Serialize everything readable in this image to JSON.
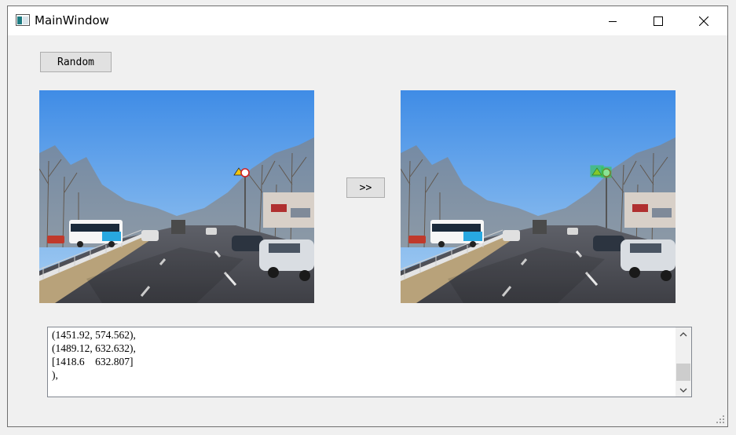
{
  "window": {
    "title": "MainWindow",
    "controls": {
      "minimize": "minimize-icon",
      "maximize": "maximize-icon",
      "close": "close-icon"
    }
  },
  "toolbar": {
    "random_label": "Random",
    "process_label": ">>"
  },
  "images": {
    "input": "street-scene-original",
    "output": "street-scene-detected"
  },
  "output_text": {
    "lines": [
      "(1451.92, 574.562),",
      "(1489.12, 632.632),",
      "[1418.6    632.807]",
      "),"
    ]
  },
  "colors": {
    "window_bg": "#f0f0f0",
    "button_bg": "#e1e1e1",
    "detection_box": "#2ecc40"
  }
}
